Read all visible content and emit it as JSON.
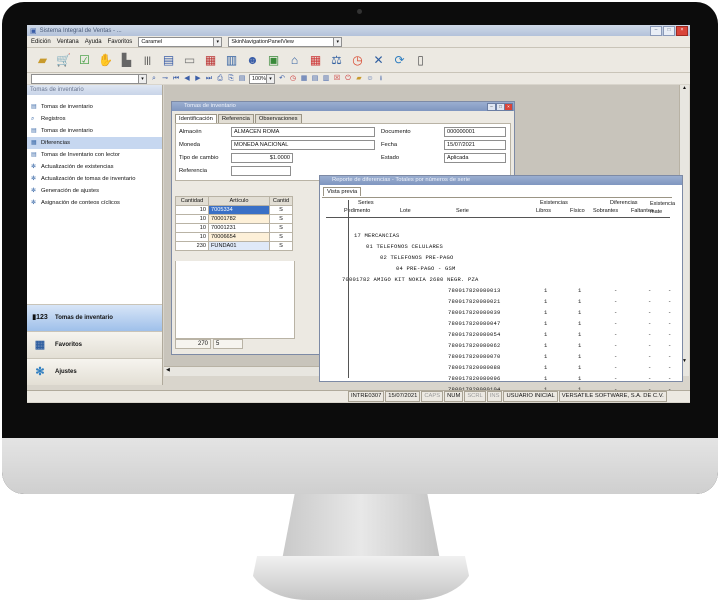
{
  "app": {
    "title": "Sistema Integral de Ventas - ..."
  },
  "menu": {
    "items": [
      "Edición",
      "Ventana",
      "Ayuda",
      "Favoritos"
    ],
    "combo1": "Caramel",
    "combo2": "SkinNavigationPanelView"
  },
  "nav": {
    "zoom": "100%"
  },
  "sidebar": {
    "header": "Tomas de inventario",
    "items": [
      {
        "label": "Tomas de inventario",
        "icon": "document-icon"
      },
      {
        "label": "Registros",
        "icon": "search-icon"
      },
      {
        "label": "Tomas de inventario",
        "icon": "document-icon"
      },
      {
        "label": "Diferencias",
        "icon": "grid-icon"
      },
      {
        "label": "Tomas de Inventario con lector",
        "icon": "document-icon"
      },
      {
        "label": "Actualización de existencias",
        "icon": "gears-icon"
      },
      {
        "label": "Actualización de tomas de inventario",
        "icon": "gears-icon"
      },
      {
        "label": "Generación de ajustes",
        "icon": "gears-icon"
      },
      {
        "label": "Asignación de conteos cíclicos",
        "icon": "gears-icon"
      }
    ],
    "selected_index": 3,
    "big_buttons": [
      "Tomas de inventario",
      "Favoritos",
      "Ajustes"
    ]
  },
  "inventory_window": {
    "title": "Tomas de inventario",
    "tabs": [
      "Identificación",
      "Referencia",
      "Observaciones"
    ],
    "almacen_label": "Almacén",
    "almacen_value": "ALMACEN ROMA",
    "moneda_label": "Moneda",
    "moneda_value": "MONEDA NACIONAL",
    "tipo_cambio_label": "Tipo de cambio",
    "tipo_cambio_value": "$1.0000",
    "referencia_label": "Referencia",
    "documento_label": "Documento",
    "documento_value": "000000001",
    "fecha_label": "Fecha",
    "fecha_value": "15/07/2021",
    "estado_label": "Estado",
    "estado_value": "Aplicada",
    "grid_headers": [
      "Cantidad",
      "Artículo",
      "Cantid"
    ],
    "grid_rows": [
      {
        "cantidad": "10",
        "articulo": "7005334",
        "btn": "S"
      },
      {
        "cantidad": "10",
        "articulo": "70001782",
        "btn": "S"
      },
      {
        "cantidad": "10",
        "articulo": "70001231",
        "btn": "S"
      },
      {
        "cantidad": "10",
        "articulo": "70006654",
        "btn": "S"
      },
      {
        "cantidad": "230",
        "articulo": "FUNDA01",
        "btn": "S"
      }
    ],
    "footer_total": "270",
    "footer_count": "5"
  },
  "report_window": {
    "title": "Reporte de diferencias - Totales por números de serie",
    "tab": "Vista previa",
    "headers": {
      "pedimento": "Pedimento",
      "series": "Series",
      "lote": "Lote",
      "serie": "Serie",
      "existencias": "Existencias",
      "libros": "Libros",
      "fisico": "Físico",
      "diferencias": "Diferencias",
      "sobrantes": "Sobrantes",
      "faltantes": "Faltantes",
      "existencia_mate": "Existencia mate"
    },
    "groups": [
      "17   MERCANCIAS",
      "01  TELEFONOS CELULARES",
      "02  TELEFONOS PRE-PAGO",
      "04  PRE-PAGO - GSM"
    ],
    "article_line": "70001782          AMIGO KIT NOKIA 2680 NEGR. PZA",
    "serial_rows": [
      {
        "serie": "780017820080013",
        "libros": "1",
        "fisico": "1",
        "sob": "-",
        "fal": "-",
        "ex": "-"
      },
      {
        "serie": "780017820080021",
        "libros": "1",
        "fisico": "1",
        "sob": "-",
        "fal": "-",
        "ex": "-"
      },
      {
        "serie": "780017820080039",
        "libros": "1",
        "fisico": "1",
        "sob": "-",
        "fal": "-",
        "ex": "-"
      },
      {
        "serie": "780017820080047",
        "libros": "1",
        "fisico": "1",
        "sob": "-",
        "fal": "-",
        "ex": "-"
      },
      {
        "serie": "780017820080054",
        "libros": "1",
        "fisico": "1",
        "sob": "-",
        "fal": "-",
        "ex": "-"
      },
      {
        "serie": "780017820080062",
        "libros": "1",
        "fisico": "1",
        "sob": "-",
        "fal": "-",
        "ex": "-"
      },
      {
        "serie": "780017820080070",
        "libros": "1",
        "fisico": "1",
        "sob": "-",
        "fal": "-",
        "ex": "-"
      },
      {
        "serie": "780017820080088",
        "libros": "1",
        "fisico": "1",
        "sob": "-",
        "fal": "-",
        "ex": "-"
      },
      {
        "serie": "780017820080096",
        "libros": "1",
        "fisico": "1",
        "sob": "-",
        "fal": "-",
        "ex": "-"
      },
      {
        "serie": "780017820080104",
        "libros": "1",
        "fisico": "1",
        "sob": "-",
        "fal": "-",
        "ex": "-"
      }
    ]
  },
  "status": {
    "user_code": "INTRE0307",
    "date": "15/07/2021",
    "caps": "CAPS",
    "num": "NUM",
    "scrl": "SCRL",
    "ins": "INS",
    "user": "USUARIO INICIAL",
    "company": "VERSATILE SOFTWARE, S.A. DE C.V."
  },
  "colors": {
    "accent": "#3b5ea8",
    "selection": "#c6d7f0"
  }
}
